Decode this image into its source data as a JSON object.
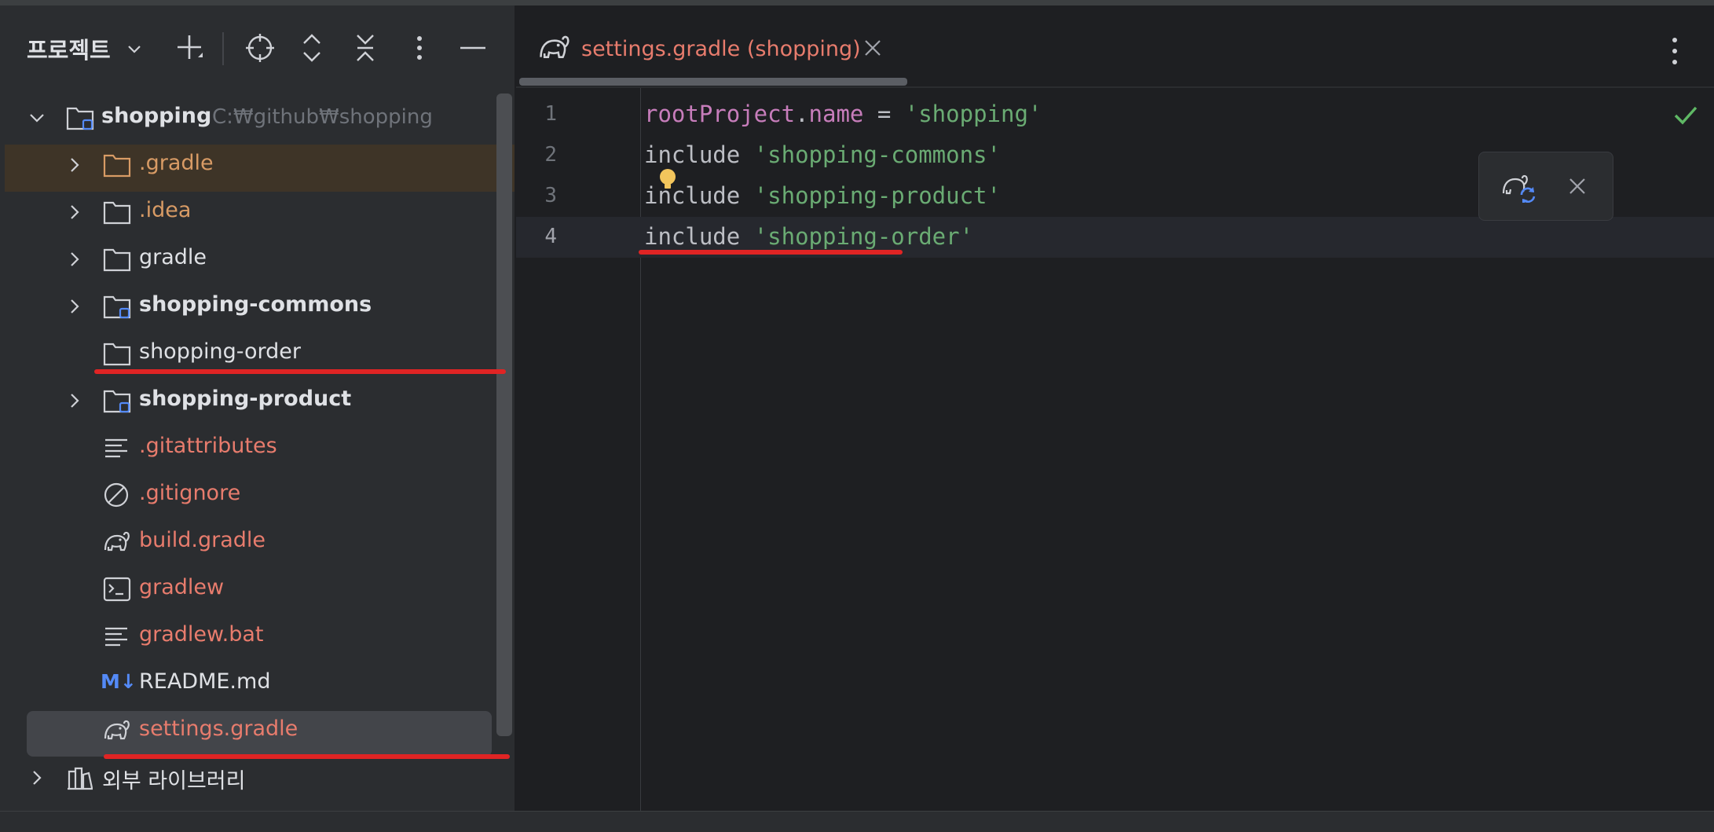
{
  "project_panel": {
    "title": "프로젝트",
    "toolbar": [
      "add-icon",
      "locate-icon",
      "expand-all-icon",
      "collapse-all-icon",
      "more-vertical-icon",
      "minimize-icon"
    ],
    "tree": [
      {
        "label": "shopping",
        "hint": "C:₩github₩shopping",
        "icon": "module-folder-icon",
        "expanded": true,
        "bold": true
      },
      {
        "label": ".gradle",
        "icon": "folder-icon",
        "color": "#d89b65"
      },
      {
        "label": ".idea",
        "icon": "folder-icon",
        "color": "#d89b65"
      },
      {
        "label": "gradle",
        "icon": "folder-icon"
      },
      {
        "label": "shopping-commons",
        "icon": "module-folder-icon",
        "bold": true
      },
      {
        "label": "shopping-order",
        "icon": "folder-icon"
      },
      {
        "label": "shopping-product",
        "icon": "module-folder-icon",
        "bold": true
      },
      {
        "label": ".gitattributes",
        "icon": "text-file-icon",
        "color": "#e87c6d"
      },
      {
        "label": ".gitignore",
        "icon": "ignore-file-icon",
        "color": "#e87c6d"
      },
      {
        "label": "build.gradle",
        "icon": "gradle-elephant-icon",
        "color": "#e87c6d"
      },
      {
        "label": "gradlew",
        "icon": "terminal-file-icon",
        "color": "#e87c6d"
      },
      {
        "label": "gradlew.bat",
        "icon": "text-file-icon",
        "color": "#e87c6d"
      },
      {
        "label": "README.md",
        "icon": "markdown-icon",
        "icon_text": "M↓"
      },
      {
        "label": "settings.gradle",
        "icon": "gradle-elephant-icon",
        "color": "#e87c6d",
        "selected": true
      },
      {
        "label": "외부 라이브러리",
        "icon": "libraries-icon"
      }
    ]
  },
  "editor": {
    "tab": {
      "label": "settings.gradle (shopping)",
      "icon": "gradle-elephant-icon",
      "color": "#e87c6d"
    },
    "lines": [
      {
        "n": "1",
        "tokens": [
          [
            "rootProject",
            "purple"
          ],
          [
            ".",
            "default"
          ],
          [
            "name",
            "purple"
          ],
          [
            " = ",
            "default"
          ],
          [
            "'shopping'",
            "green"
          ]
        ]
      },
      {
        "n": "2",
        "tokens": [
          [
            "include ",
            "default"
          ],
          [
            "'shopping-commons'",
            "green"
          ]
        ]
      },
      {
        "n": "3",
        "tokens": [
          [
            "include ",
            "default"
          ],
          [
            "'shopping-product'",
            "green"
          ]
        ]
      },
      {
        "n": "4",
        "tokens": [
          [
            "include ",
            "default"
          ],
          [
            "'shopping-order'",
            "green"
          ]
        ],
        "current": true
      }
    ],
    "status_icon": "check-icon",
    "popup": {
      "icons": [
        "gradle-sync-icon",
        "close-icon"
      ]
    }
  },
  "colors": {
    "accent_blue": "#548af7",
    "highlight_red": "#e02424",
    "string_green": "#6aab73",
    "keyword_purple": "#c77dbb"
  }
}
